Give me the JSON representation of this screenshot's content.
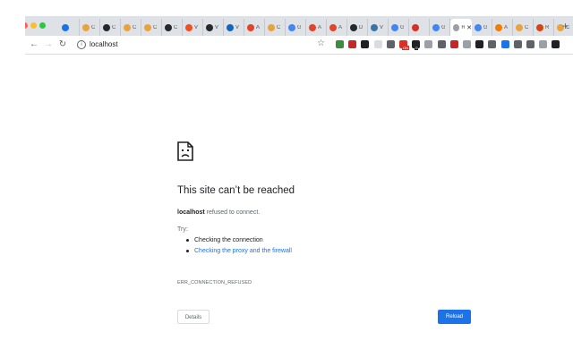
{
  "colors": {
    "close": "#ff5f57",
    "minimize": "#febc2e",
    "maximize": "#28c840",
    "accent": "#1a73e8"
  },
  "tabs": [
    {
      "icon": "puzzle-icon",
      "color": "#1a73e8",
      "title": ""
    },
    {
      "icon": "chrome-icon",
      "color": "#e8a33d",
      "title": "C"
    },
    {
      "icon": "github-icon",
      "color": "#24292e",
      "title": "C"
    },
    {
      "icon": "chrome-icon",
      "color": "#e8a33d",
      "title": "C"
    },
    {
      "icon": "chrome-icon",
      "color": "#e8a33d",
      "title": "C"
    },
    {
      "icon": "github-icon",
      "color": "#24292e",
      "title": "C"
    },
    {
      "icon": "microsoft-icon",
      "color": "#f25022",
      "title": "V"
    },
    {
      "icon": "github-icon",
      "color": "#24292e",
      "title": "V"
    },
    {
      "icon": "app-icon",
      "color": "#1565c0",
      "title": "V"
    },
    {
      "icon": "gitlab-icon",
      "color": "#e24329",
      "title": "A"
    },
    {
      "icon": "chrome-icon",
      "color": "#e8a33d",
      "title": "C"
    },
    {
      "icon": "google-icon",
      "color": "#4285f4",
      "title": "G"
    },
    {
      "icon": "gitlab-icon",
      "color": "#e24329",
      "title": "A"
    },
    {
      "icon": "gitlab-icon",
      "color": "#e24329",
      "title": "A"
    },
    {
      "icon": "github-icon",
      "color": "#24292e",
      "title": "D"
    },
    {
      "icon": "python-icon",
      "color": "#3776ab",
      "title": "V"
    },
    {
      "icon": "google-icon",
      "color": "#4285f4",
      "title": "G"
    },
    {
      "icon": "gmail-icon",
      "color": "#d93025",
      "title": ""
    },
    {
      "icon": "google-icon",
      "color": "#4285f4",
      "title": "G"
    },
    {
      "icon": "page-icon",
      "color": "#9aa0a6",
      "title": "R",
      "active": true
    },
    {
      "icon": "google-icon",
      "color": "#4285f4",
      "title": "G"
    },
    {
      "icon": "app-icon",
      "color": "#f57c00",
      "title": "A"
    },
    {
      "icon": "chrome-icon",
      "color": "#e8a33d",
      "title": "C"
    },
    {
      "icon": "app-icon",
      "color": "#d84315",
      "title": "R"
    },
    {
      "icon": "chrome-icon",
      "color": "#e8a33d",
      "title": "C"
    },
    {
      "icon": "chrome-icon",
      "color": "#e8a33d",
      "title": "C"
    }
  ],
  "new_tab_label": "+",
  "url": "localhost",
  "extensions": [
    "#3c8c40",
    "#c62828",
    "#202124",
    "#dadce0",
    "#5f6368",
    "#d93025",
    "#202124",
    "#9aa0a6",
    "#5f6368",
    "#c62828",
    "#9aa0a6",
    "#202124",
    "#5f6368",
    "#1a73e8",
    "#5f6368",
    "#5f6368",
    "#9aa0a6",
    "#202124"
  ],
  "ext_badges": [
    {
      "index": 5,
      "text": "ON",
      "color": "#d93025"
    },
    {
      "index": 6,
      "text": "0",
      "color": "#202124"
    }
  ],
  "error": {
    "title": "This site can’t be reached",
    "host": "localhost",
    "message_rest": " refused to connect.",
    "try_label": "Try:",
    "suggestions": [
      {
        "text": "Checking the connection",
        "link": false
      },
      {
        "text": "Checking the proxy and the firewall",
        "link": true
      }
    ],
    "code": "ERR_CONNECTION_REFUSED",
    "details_label": "Details",
    "reload_label": "Reload"
  }
}
